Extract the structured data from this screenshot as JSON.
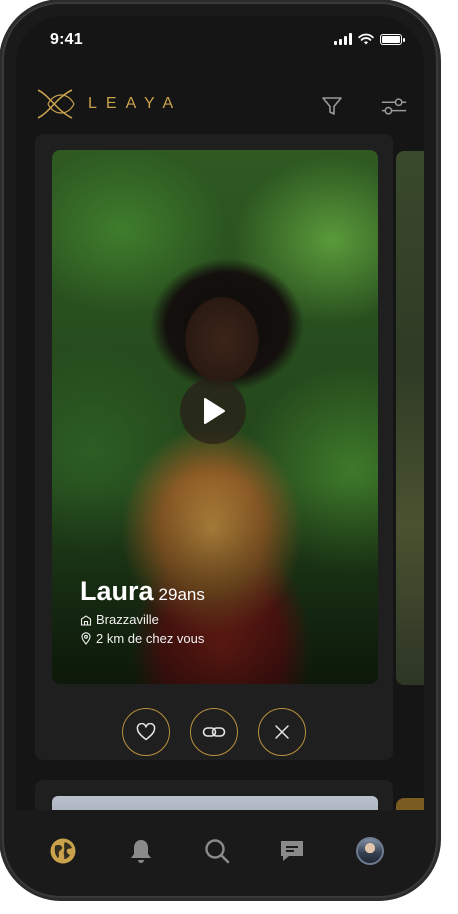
{
  "status_bar": {
    "time": "9:41"
  },
  "header": {
    "logo_text": "LEAYA",
    "icons": [
      "logo-icon",
      "filter-icon",
      "settings-sliders-icon"
    ]
  },
  "profile": {
    "name": "Laura",
    "age": "29",
    "age_unit": "ans",
    "city": "Brazzaville",
    "distance": "2 km de chez vous"
  },
  "actions": [
    "heart-icon",
    "link-icon",
    "close-icon"
  ],
  "tabbar": {
    "items": [
      "globe-icon",
      "bell-icon",
      "search-icon",
      "chat-icon",
      "avatar"
    ],
    "active": "globe-icon"
  },
  "colors": {
    "background": "#151515",
    "card": "#1f1f1f",
    "accent_gold": "#c9a24b",
    "icon_gray": "#9a9a9a"
  }
}
